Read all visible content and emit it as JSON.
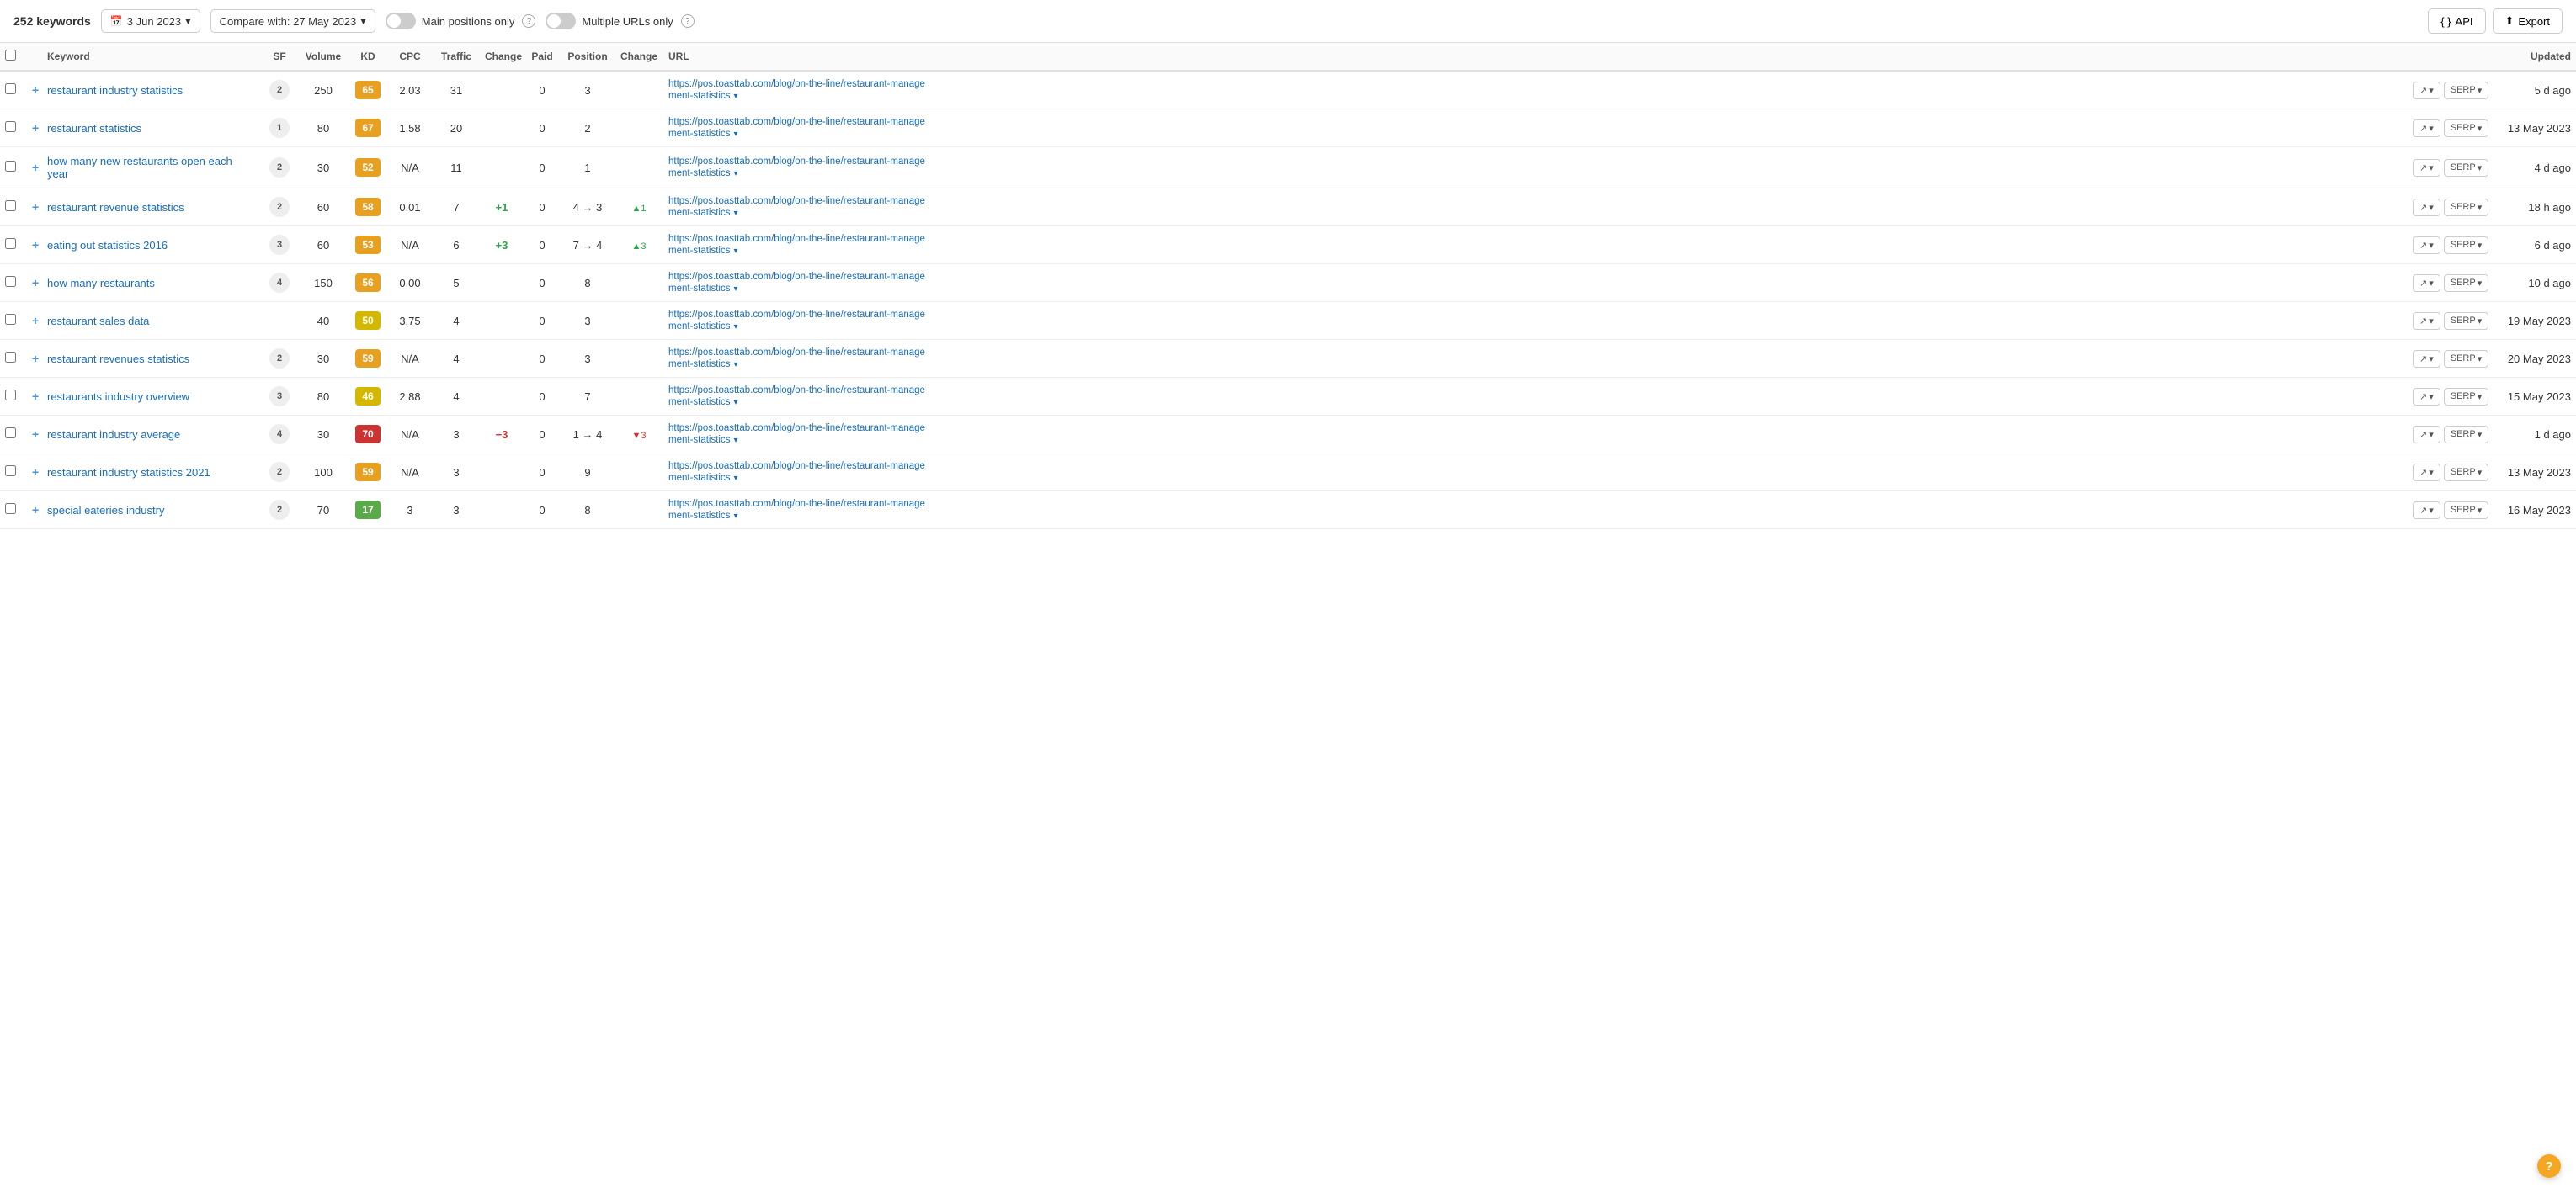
{
  "topbar": {
    "keywords_count": "252 keywords",
    "date_current": "3 Jun 2023",
    "date_compare_label": "Compare with: 27 May 2023",
    "main_positions_only_label": "Main positions only",
    "multiple_urls_only_label": "Multiple URLs only",
    "api_label": "API",
    "export_label": "Export"
  },
  "table": {
    "columns": [
      "",
      "",
      "Keyword",
      "SF",
      "Volume",
      "KD",
      "CPC",
      "Traffic",
      "Change",
      "Paid",
      "Position",
      "Change",
      "URL",
      "",
      "Updated"
    ],
    "rows": [
      {
        "keyword": "restaurant industry statistics",
        "sf": "2",
        "volume": "250",
        "kd": "65",
        "kd_class": "kd-orange",
        "cpc": "2.03",
        "traffic": "31",
        "change": "",
        "paid": "0",
        "position": "3",
        "position_change": "",
        "position_change_val": "",
        "url": "https://pos.toasttab.com/blog/on-the-line/restaurant-management-statistics",
        "updated": "5 d ago"
      },
      {
        "keyword": "restaurant statistics",
        "sf": "1",
        "volume": "80",
        "kd": "67",
        "kd_class": "kd-orange",
        "cpc": "1.58",
        "traffic": "20",
        "change": "",
        "paid": "0",
        "position": "2",
        "position_change": "",
        "position_change_val": "",
        "url": "https://pos.toasttab.com/blog/on-the-line/restaurant-management-statistics",
        "updated": "13 May 2023"
      },
      {
        "keyword": "how many new restaurants open each year",
        "sf": "2",
        "volume": "30",
        "kd": "52",
        "kd_class": "kd-orange",
        "cpc": "N/A",
        "traffic": "11",
        "change": "",
        "paid": "0",
        "position": "1",
        "position_change": "",
        "position_change_val": "",
        "url": "https://pos.toasttab.com/blog/on-the-line/restaurant-management-statistics",
        "updated": "4 d ago"
      },
      {
        "keyword": "restaurant revenue statistics",
        "sf": "2",
        "volume": "60",
        "kd": "58",
        "kd_class": "kd-orange",
        "cpc": "0.01",
        "traffic": "7",
        "change": "+1",
        "change_type": "pos",
        "paid": "0",
        "position": "4 → 3",
        "position_change": "▲1",
        "position_change_type": "pos",
        "url": "https://pos.toasttab.com/blog/on-the-line/restaurant-management-statistics",
        "updated": "18 h ago"
      },
      {
        "keyword": "eating out statistics 2016",
        "sf": "3",
        "volume": "60",
        "kd": "53",
        "kd_class": "kd-orange",
        "cpc": "N/A",
        "traffic": "6",
        "change": "+3",
        "change_type": "pos",
        "paid": "0",
        "position": "7 → 4",
        "position_change": "▲3",
        "position_change_type": "pos",
        "url": "https://pos.toasttab.com/blog/on-the-line/restaurant-management-statistics",
        "updated": "6 d ago"
      },
      {
        "keyword": "how many restaurants",
        "sf": "4",
        "volume": "150",
        "kd": "56",
        "kd_class": "kd-orange",
        "cpc": "0.00",
        "traffic": "5",
        "change": "",
        "paid": "0",
        "position": "8",
        "position_change": "",
        "position_change_val": "",
        "url": "https://pos.toasttab.com/blog/on-the-line/restaurant-management-statistics",
        "updated": "10 d ago"
      },
      {
        "keyword": "restaurant sales data",
        "sf": "",
        "volume": "40",
        "kd": "50",
        "kd_class": "kd-yellow",
        "cpc": "3.75",
        "traffic": "4",
        "change": "",
        "paid": "0",
        "position": "3",
        "position_change": "",
        "position_change_val": "",
        "url": "https://pos.toasttab.com/blog/on-the-line/restaurant-management-statistics",
        "updated": "19 May 2023"
      },
      {
        "keyword": "restaurant revenues statistics",
        "sf": "2",
        "volume": "30",
        "kd": "59",
        "kd_class": "kd-orange",
        "cpc": "N/A",
        "traffic": "4",
        "change": "",
        "paid": "0",
        "position": "3",
        "position_change": "",
        "position_change_val": "",
        "url": "https://pos.toasttab.com/blog/on-the-line/restaurant-management-statistics",
        "updated": "20 May 2023"
      },
      {
        "keyword": "restaurants industry overview",
        "sf": "3",
        "volume": "80",
        "kd": "46",
        "kd_class": "kd-yellow",
        "cpc": "2.88",
        "traffic": "4",
        "change": "",
        "paid": "0",
        "position": "7",
        "position_change": "",
        "position_change_val": "",
        "url": "https://pos.toasttab.com/blog/on-the-line/restaurant-management-statistics",
        "updated": "15 May 2023"
      },
      {
        "keyword": "restaurant industry average",
        "sf": "4",
        "volume": "30",
        "kd": "70",
        "kd_class": "kd-red",
        "cpc": "N/A",
        "traffic": "3",
        "change": "−3",
        "change_type": "neg",
        "paid": "0",
        "position": "1 → 4",
        "position_change": "▼3",
        "position_change_type": "neg",
        "url": "https://pos.toasttab.com/blog/on-the-line/restaurant-management-statistics",
        "updated": "1 d ago"
      },
      {
        "keyword": "restaurant industry statistics 2021",
        "sf": "2",
        "volume": "100",
        "kd": "59",
        "kd_class": "kd-orange",
        "cpc": "N/A",
        "traffic": "3",
        "change": "",
        "paid": "0",
        "position": "9",
        "position_change": "",
        "position_change_val": "",
        "url": "https://pos.toasttab.com/blog/on-the-line/restaurant-management-statistics",
        "updated": "13 May 2023"
      },
      {
        "keyword": "special eateries industry",
        "sf": "2",
        "volume": "70",
        "kd": "17",
        "kd_class": "kd-green",
        "cpc": "3",
        "traffic": "3",
        "change": "",
        "paid": "0",
        "position": "8",
        "position_change": "",
        "position_change_val": "",
        "url": "https://pos.toasttab.com/blog/on-the-line/restaurant-management-statistics",
        "updated": "16 May 2023"
      }
    ]
  },
  "help": "?"
}
